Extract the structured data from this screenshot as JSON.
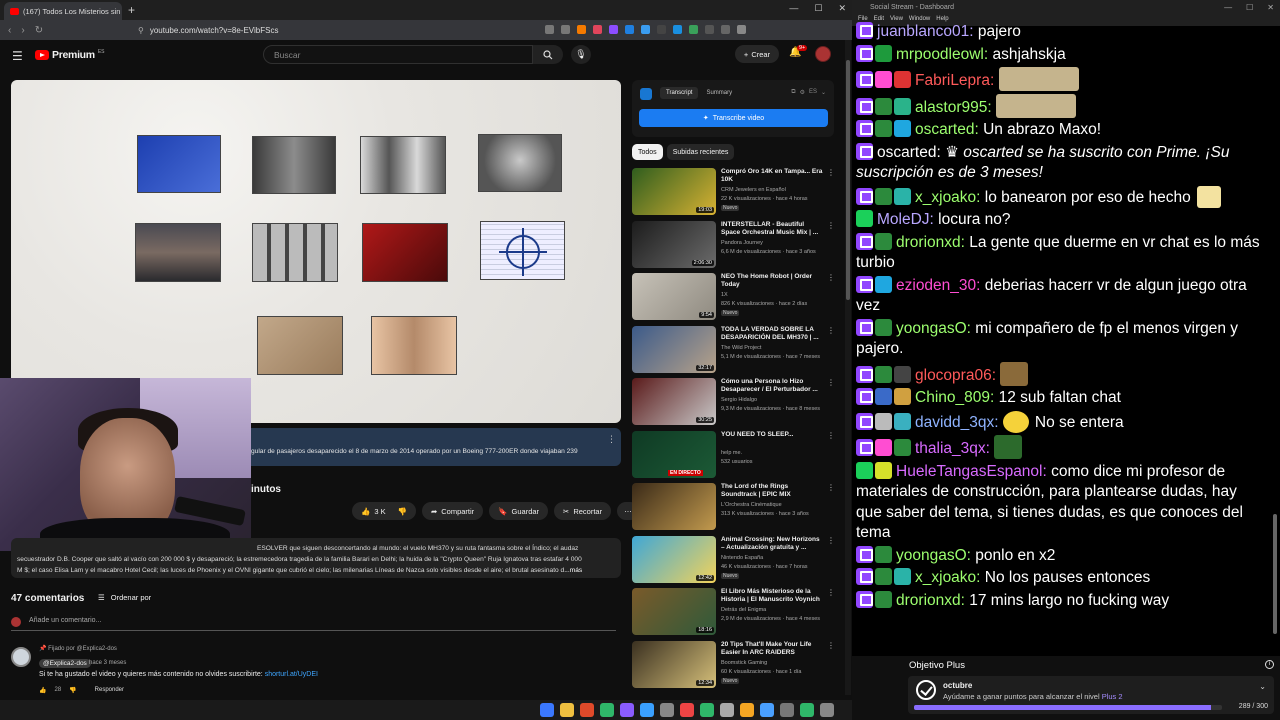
{
  "browser": {
    "tab_title": "(167) Todos Los Misterios sin Re",
    "url": "youtube.com/watch?v=8e-EVibFScs"
  },
  "youtube": {
    "logo_text": "Premium",
    "logo_cc": "ES",
    "search_placeholder": "Buscar",
    "create_label": "Crear",
    "notif_count": "9+",
    "player_notice": "gular de pasajeros desaparecido el 8 de marzo de 2014 operado por un Boeing 777-200ER donde viajaban 239",
    "title_fragment": "inutos",
    "actions": {
      "likes": "3 K",
      "share": "Compartir",
      "save": "Guardar",
      "clip": "Recortar"
    },
    "description_line1": "ESOLVER que siguen desconcertando al mundo: el vuelo MH370 y su ruta fantasma sobre el Índico; el audaz",
    "description_line2": "secuestrador D.B. Cooper que saltó al vacío con 200 000 $ y desapareció; la estremecedora tragedia de la familia Barari en Delhi; la huida de la \"Crypto Queen\" Ruja Ignatova tras estafar 4 000",
    "description_line3": "M $; el caso Elisa Lam y el macabro Hotel Cecil; las luces de Phoenix y el OVNI gigante que cubrió el cielo; las milenarias Líneas de Nazca solo visibles desde el aire; el brutal asesinato d",
    "description_more": "...más",
    "comments_count": "47 comentarios",
    "sort_label": "Ordenar por",
    "add_comment": "Añade un comentario...",
    "pinned_comment": {
      "pinned_by": "Fijado por @Explica2-dos",
      "author": "@Explica2-dos",
      "time": "hace 3 meses",
      "text": "Si te ha gustado el video y quieres más contenido no olvides suscribirte: ",
      "link": "shorturl.at/UyDEI",
      "likes": "28",
      "reply": "Responder"
    },
    "extension": {
      "tab_transcript": "Transcript",
      "tab_summary": "Summary",
      "button": "Transcribe video",
      "lang": "ES"
    },
    "chips": [
      "Todos",
      "Subidas recientes"
    ],
    "recommendations": [
      {
        "title": "Compró Oro 14K en Tampa... Era 10K",
        "channel": "CRM Jewelers en Español",
        "meta": "22 K visualizaciones · hace 4 horas",
        "badge": "Nuevo",
        "duration": "19:03",
        "color1": "#2f5d1e",
        "color2": "#d8b233"
      },
      {
        "title": "INTERSTELLAR - Beautiful Space Orchestral Music Mix | ...",
        "channel": "Pandora Journey",
        "meta": "6,6 M de visualizaciones · hace 3 años",
        "badge": "",
        "duration": "2:06:30",
        "color1": "#1c1c1c",
        "color2": "#6b6b6b"
      },
      {
        "title": "NEO The Home Robot | Order Today",
        "channel": "1X",
        "meta": "826 K visualizaciones · hace 2 días",
        "badge": "Nuevo",
        "duration": "9:54",
        "color1": "#c7c2b8",
        "color2": "#8f8a80"
      },
      {
        "title": "TODA LA VERDAD SOBRE LA DESAPARICIÓN DEL MH370 | ...",
        "channel": "The Wild Project",
        "meta": "5,1 M de visualizaciones · hace 7 meses",
        "badge": "",
        "duration": "32:17",
        "color1": "#3b5a8a",
        "color2": "#b8a38a"
      },
      {
        "title": "Cómo una Persona lo Hizo Desaparecer / El Perturbador ...",
        "channel": "Sergio Hidalgo",
        "meta": "9,3 M de visualizaciones · hace 8 meses",
        "badge": "",
        "duration": "30:25",
        "color1": "#5a1a1a",
        "color2": "#c9c9c9"
      },
      {
        "title": "YOU NEED TO SLEEP...",
        "channel": "help me.",
        "meta": "532 usuarios",
        "badge": "",
        "duration": "",
        "live": "EN DIRECTO",
        "color1": "#0f3a24",
        "color2": "#1c5a36"
      },
      {
        "title": "The Lord of the Rings Soundtrack | EPIC MIX",
        "channel": "L'Orchestra Cinématique",
        "meta": "313 K visualizaciones · hace 3 años",
        "badge": "",
        "duration": "",
        "color1": "#3a2a18",
        "color2": "#c29a4e"
      },
      {
        "title": "Animal Crossing: New Horizons – Actualización gratuita y ...",
        "channel": "Nintendo España",
        "meta": "46 K visualizaciones · hace 7 horas",
        "badge": "Nuevo",
        "duration": "12:42",
        "color1": "#3fa7d6",
        "color2": "#f2d35b"
      },
      {
        "title": "El Libro Más Misterioso de la Historia | El Manuscrito Voynich",
        "channel": "Detrás del Enigma",
        "meta": "2,9 M de visualizaciones · hace 4 meses",
        "badge": "",
        "duration": "18:16",
        "color1": "#7a5a2a",
        "color2": "#2f5a3a"
      },
      {
        "title": "20 Tips That'll Make Your Life Easier In ARC RAIDERS",
        "channel": "Boomstick Gaming",
        "meta": "60 K visualizaciones · hace 1 día",
        "badge": "Nuevo",
        "duration": "12:34",
        "color1": "#3a3020",
        "color2": "#d6c07a"
      }
    ]
  },
  "stream": {
    "window_title": "Social Stream - Dashboard",
    "menu": [
      "File",
      "Edit",
      "View",
      "Window",
      "Help"
    ],
    "messages": [
      {
        "user": "juanblanco01",
        "color": "#b9a7ff",
        "text": "pajero",
        "badges": [
          "#9146ff"
        ]
      },
      {
        "user": "mrpoodleowl",
        "color": "#9dff6f",
        "text": "ashjahskja",
        "badges": [
          "#9146ff",
          "#1e9a3c"
        ]
      },
      {
        "user": "FabriLepra",
        "color": "#ff5a5a",
        "text": "",
        "badges": [
          "#9146ff",
          "#ff4dd2",
          "#d33"
        ],
        "emote": "#c5b48d"
      },
      {
        "user": "alastor995",
        "color": "#9dff6f",
        "text": "",
        "badges": [
          "#9146ff",
          "#2c8a3c",
          "#2ab38a"
        ],
        "emote": "#c5b48d"
      },
      {
        "user": "oscarted",
        "color": "#9dff6f",
        "text": "Un abrazo Maxo!",
        "badges": [
          "#9146ff",
          "#2c8a3c",
          "#1fa7e0"
        ]
      },
      {
        "user": "oscarted",
        "color": "#ffffff",
        "text": "oscarted se ha suscrito con Prime. ¡Su suscripción es de 3 meses!",
        "badges": [
          "#9146ff"
        ],
        "system": true
      },
      {
        "user": "x_xjoako",
        "color": "#9dff6f",
        "text": "lo banearon por eso de hecho",
        "badges": [
          "#9146ff",
          "#2c8a3c",
          "#2ab3a8"
        ],
        "emote_after": "#f3e2a0"
      },
      {
        "user": "MoleDJ",
        "color": "#b9a7ff",
        "text": "locura no?",
        "badges": [
          "#1bd05a"
        ]
      },
      {
        "user": "drorionxd",
        "color": "#9dff6f",
        "text": "La gente que duerme en vr chat es lo más turbio",
        "badges": [
          "#9146ff",
          "#2c8a3c"
        ]
      },
      {
        "user": "ezioden_30",
        "color": "#ff4dd2",
        "text": "deberias hacerr vr de algun juego otra vez",
        "badges": [
          "#9146ff",
          "#1fa7e0"
        ]
      },
      {
        "user": "yoongasO",
        "color": "#9dff6f",
        "text": "mi compañero de fp el menos virgen y pajero.",
        "badges": [
          "#9146ff",
          "#2c8a3c"
        ]
      },
      {
        "user": "glocopra06",
        "color": "#ff5a5a",
        "text": "",
        "badges": [
          "#9146ff",
          "#2c8a3c",
          "#444"
        ],
        "emote": "#8a6a3a"
      },
      {
        "user": "Chino_809",
        "color": "#9dff6f",
        "text": "12 sub faltan chat",
        "badges": [
          "#9146ff",
          "#3a6ac8",
          "#d0a040"
        ]
      },
      {
        "user": "davidd_3qx",
        "color": "#8fb3ff",
        "text": "No se entera",
        "badges": [
          "#9146ff",
          "#bbb",
          "#3ab0c0"
        ],
        "emote_mid": "#f5d23a"
      },
      {
        "user": "thalia_3qx",
        "color": "#d86bff",
        "text": "",
        "badges": [
          "#9146ff",
          "#ff4dd2",
          "#2c8a3c"
        ],
        "emote": "#2c6a2c"
      },
      {
        "user": "HueleTangasEspanol",
        "color": "#d86bff",
        "text": "como dice mi profesor de materiales de construcción, para plantearse dudas, hay que saber del tema, si tienes dudas, es que conoces del tema",
        "badges": [
          "#1bd05a",
          "#d6e02a"
        ]
      },
      {
        "user": "yoongasO",
        "color": "#9dff6f",
        "text": "ponlo en x2",
        "badges": [
          "#9146ff",
          "#2c8a3c"
        ]
      },
      {
        "user": "x_xjoako",
        "color": "#9dff6f",
        "text": "No los pauses entonces",
        "badges": [
          "#9146ff",
          "#2c8a3c",
          "#2ab3a8"
        ]
      },
      {
        "user": "drorionxd",
        "color": "#9dff6f",
        "text": "17 mins largo no fucking way",
        "badges": [
          "#9146ff",
          "#2c8a3c"
        ]
      }
    ],
    "goal": {
      "title": "Objetivo Plus",
      "name": "octubre",
      "desc": "Ayúdame a ganar puntos para alcanzar el nivel ",
      "plus": "Plus 2",
      "current": 289,
      "target": 300,
      "count": "289 / 300"
    }
  },
  "taskbar_colors": [
    "#3b78ff",
    "#f0c040",
    "#e04a2a",
    "#2fb86a",
    "#8a5cff",
    "#3aa0ff",
    "#888",
    "#e44",
    "#2fb86a",
    "#aaa",
    "#f5a623",
    "#4aa0ff",
    "#777",
    "#2fb86a",
    "#888"
  ]
}
